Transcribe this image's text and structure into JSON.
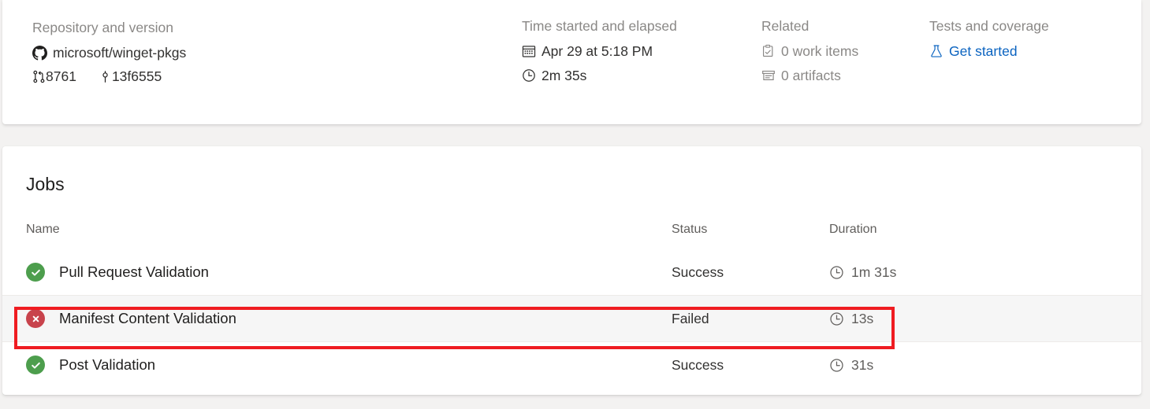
{
  "summary": {
    "columns": [
      {
        "title": "Repository and version",
        "repo_icon": "github-icon",
        "repo": "microsoft/winget-pkgs",
        "pr_icon": "pull-request-icon",
        "pr_number": "8761",
        "commit_icon": "commit-icon",
        "commit": "13f6555"
      },
      {
        "title": "Time started and elapsed",
        "calendar_icon": "calendar-icon",
        "started": "Apr 29 at 5:18 PM",
        "clock_icon": "clock-icon",
        "elapsed": "2m 35s"
      },
      {
        "title": "Related",
        "work_items_icon": "clipboard-check-icon",
        "work_items": "0 work items",
        "artifacts_icon": "artifact-box-icon",
        "artifacts": "0 artifacts"
      },
      {
        "title": "Tests and coverage",
        "flask_icon": "flask-icon",
        "link": "Get started"
      }
    ]
  },
  "jobs": {
    "heading": "Jobs",
    "headers": {
      "name": "Name",
      "status": "Status",
      "duration": "Duration"
    },
    "rows": [
      {
        "name": "Pull Request Validation",
        "status": "Success",
        "state": "success",
        "status_icon": "check-circle-icon",
        "duration": "1m 31s",
        "duration_icon": "clock-icon",
        "highlighted": false
      },
      {
        "name": "Manifest Content Validation",
        "status": "Failed",
        "state": "failed",
        "status_icon": "error-circle-icon",
        "duration": "13s",
        "duration_icon": "clock-icon",
        "highlighted": true
      },
      {
        "name": "Post Validation",
        "status": "Success",
        "state": "success",
        "status_icon": "check-circle-icon",
        "duration": "31s",
        "duration_icon": "clock-icon",
        "highlighted": false
      }
    ]
  },
  "annotation": {
    "name": "highlight-rectangle",
    "color": "#ef1c21",
    "target_row": "Manifest Content Validation"
  },
  "colors": {
    "page_background": "#f3f2f1",
    "card_background": "#ffffff",
    "link": "#0a63c0",
    "success": "#4d9e4d",
    "failed": "#c8434c",
    "muted_text": "#8a8886",
    "annotation": "#ef1c21"
  }
}
